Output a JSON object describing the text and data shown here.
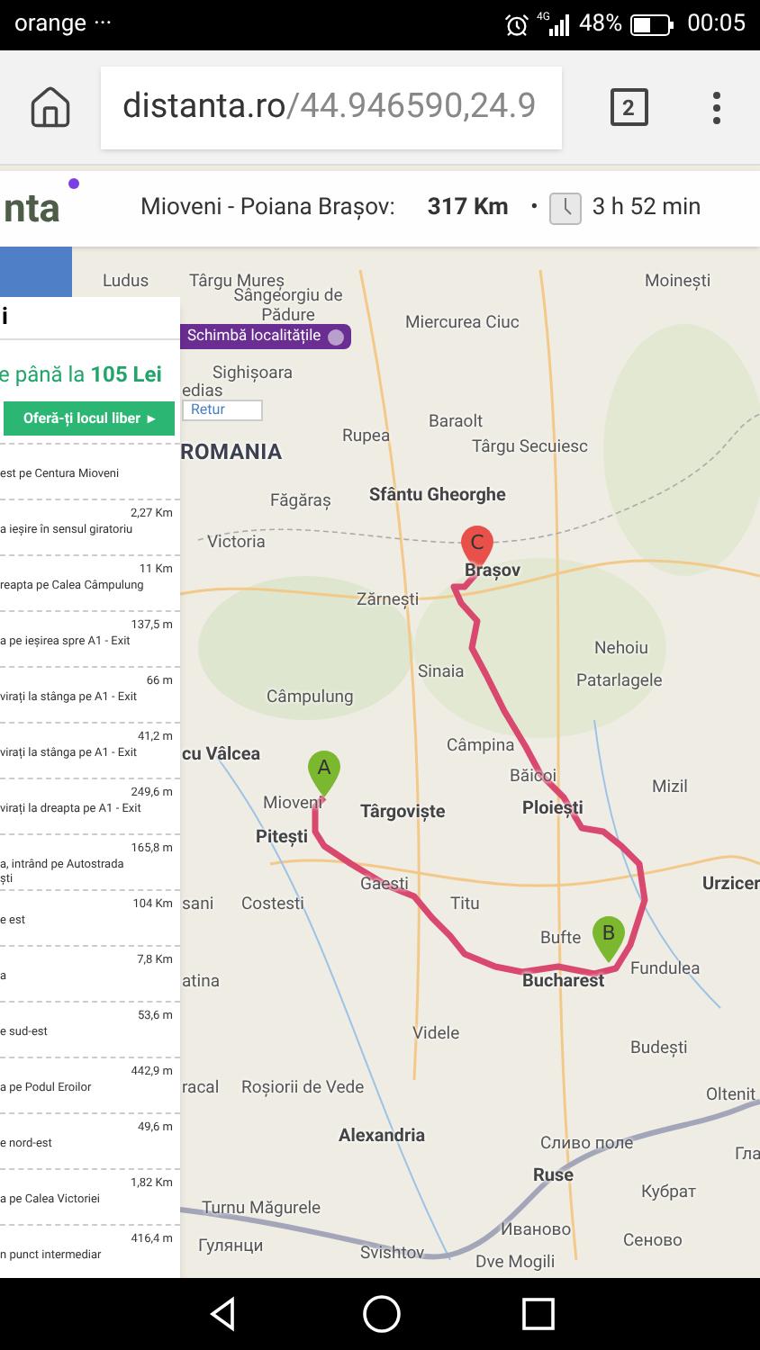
{
  "status_bar": {
    "carrier": "orange",
    "more": "···",
    "network": "4G",
    "battery": "48%",
    "time": "00:05"
  },
  "browser": {
    "url_host": "distanta.ro",
    "url_path": "/44.946590,24.9",
    "tab_count": "2"
  },
  "route_header": {
    "logo": "nta",
    "route": "Mioveni - Poiana Brașov:",
    "distance": "317 Km",
    "separator": "•",
    "duration": "3 h 52 min"
  },
  "sidebar": {
    "title": "i",
    "offer": "e până la **105 Lei**",
    "offer_button": "Oferă-ți locul liber",
    "offer_button_arrow": "▸",
    "steps": [
      {
        "instruction": "est pe Centura Mioveni"
      },
      {
        "distance": "2,27 Km",
        "instruction": "a ieșire în sensul giratoriu"
      },
      {
        "distance": "11 Km",
        "instruction": "reapta pe Calea Câmpulung"
      },
      {
        "distance": "137,5 m",
        "instruction": "a pe ieșirea spre A1 - Exit"
      },
      {
        "distance": "66 m",
        "instruction": "virați la stânga pe A1 - Exit"
      },
      {
        "distance": "41,2 m",
        "instruction": "virați la stânga pe A1 - Exit"
      },
      {
        "distance": "249,6 m",
        "instruction": "virați la dreapta pe A1 - Exit"
      },
      {
        "distance": "165,8 m",
        "instruction": "a, intrând pe Autostrada\nști"
      },
      {
        "distance": "104 Km",
        "instruction": "e est"
      },
      {
        "distance": "7,8 Km",
        "instruction": "a"
      },
      {
        "distance": "53,6 m",
        "instruction": "e sud-est"
      },
      {
        "distance": "442,9 m",
        "instruction": "a pe Podul Eroilor"
      },
      {
        "distance": "49,6 m",
        "instruction": "e nord-est"
      },
      {
        "distance": "1,82 Km",
        "instruction": "a pe Calea Victoriei"
      },
      {
        "distance": "416,4 m",
        "instruction": "n punct intermediar"
      }
    ]
  },
  "map": {
    "change_button": "Schimbă localitățile",
    "return_button": "Retur",
    "markers": [
      {
        "letter": "A",
        "color": "#7cb82f"
      },
      {
        "letter": "B",
        "color": "#7cb82f"
      },
      {
        "letter": "C",
        "color": "#e8514a"
      }
    ],
    "labels": [
      {
        "text": "Ludus",
        "kind": "town"
      },
      {
        "text": "Târgu Mureș",
        "kind": "town"
      },
      {
        "text": "Sângeorgiu de Pădure",
        "kind": "town"
      },
      {
        "text": "Moinești",
        "kind": "town"
      },
      {
        "text": "Miercurea Ciuc",
        "kind": "town"
      },
      {
        "text": "Sighișoara",
        "kind": "town"
      },
      {
        "text": "edias",
        "kind": "town"
      },
      {
        "text": "Baraolt",
        "kind": "town"
      },
      {
        "text": "Rupea",
        "kind": "town"
      },
      {
        "text": "ROMANIA",
        "kind": "country"
      },
      {
        "text": "Târgu Secuiesc",
        "kind": "town"
      },
      {
        "text": "Făgăraș",
        "kind": "town"
      },
      {
        "text": "Sfântu Gheorghe",
        "kind": "major"
      },
      {
        "text": "Victoria",
        "kind": "town"
      },
      {
        "text": "Brașov",
        "kind": "major"
      },
      {
        "text": "Zărnești",
        "kind": "town"
      },
      {
        "text": "Nehoiu",
        "kind": "town"
      },
      {
        "text": "Sinaia",
        "kind": "town"
      },
      {
        "text": "Patarlagele",
        "kind": "town"
      },
      {
        "text": "Câmpulung",
        "kind": "town"
      },
      {
        "text": "Câmpina",
        "kind": "town"
      },
      {
        "text": "cu Vâlcea",
        "kind": "major"
      },
      {
        "text": "Băicoi",
        "kind": "town"
      },
      {
        "text": "Mizil",
        "kind": "town"
      },
      {
        "text": "Mioveni",
        "kind": "town"
      },
      {
        "text": "Târgoviște",
        "kind": "major"
      },
      {
        "text": "Ploiești",
        "kind": "major"
      },
      {
        "text": "Pitești",
        "kind": "major"
      },
      {
        "text": "Urzicer",
        "kind": "major"
      },
      {
        "text": "Gaesti",
        "kind": "town"
      },
      {
        "text": "sani",
        "kind": "town"
      },
      {
        "text": "Costesti",
        "kind": "town"
      },
      {
        "text": "Titu",
        "kind": "town"
      },
      {
        "text": "Bufte",
        "kind": "town"
      },
      {
        "text": "Fundulea",
        "kind": "town"
      },
      {
        "text": "Bucharest",
        "kind": "major"
      },
      {
        "text": "atina",
        "kind": "town"
      },
      {
        "text": "Videle",
        "kind": "town"
      },
      {
        "text": "Budești",
        "kind": "town"
      },
      {
        "text": "Oltenit",
        "kind": "town"
      },
      {
        "text": "racal",
        "kind": "town"
      },
      {
        "text": "Roșiorii de Vede",
        "kind": "town"
      },
      {
        "text": "Alexandria",
        "kind": "major"
      },
      {
        "text": "Сливо поле",
        "kind": "town"
      },
      {
        "text": "Гла",
        "kind": "town"
      },
      {
        "text": "Ruse",
        "kind": "major"
      },
      {
        "text": "Кубрат",
        "kind": "town"
      },
      {
        "text": "Turnu Măgurele",
        "kind": "town"
      },
      {
        "text": "Иваново",
        "kind": "town"
      },
      {
        "text": "Сеново",
        "kind": "town"
      },
      {
        "text": "Гулянци",
        "kind": "town"
      },
      {
        "text": "Svishtov",
        "kind": "town"
      },
      {
        "text": "Dve Mogili",
        "kind": "town"
      }
    ]
  }
}
